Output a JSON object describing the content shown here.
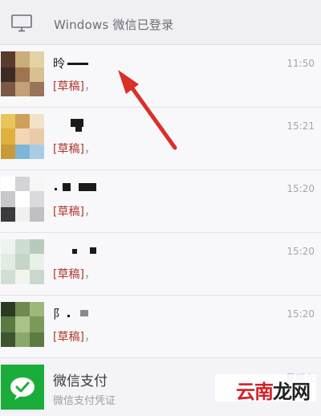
{
  "banner": {
    "text": "Windows 微信已登录",
    "icon": "monitor-icon"
  },
  "chats": [
    {
      "name_lead": "昤",
      "time": "11:50",
      "draft": "[草稿]",
      "comma": "，"
    },
    {
      "name_lead": "",
      "time": "15:21",
      "draft": "[草稿]",
      "comma": "，"
    },
    {
      "name_lead": "",
      "time": "15:20",
      "draft": "[草稿]",
      "comma": "，"
    },
    {
      "name_lead": "",
      "time": "15:20",
      "draft": "[草稿]",
      "comma": "，"
    },
    {
      "name_lead": "阝",
      "time": "15:20",
      "draft": "[草稿]",
      "comma": "，"
    }
  ],
  "pay": {
    "title": "微信支付",
    "subtitle": "微信支付凭证",
    "time": "星期六",
    "icon": "wechat-pay-icon"
  },
  "watermark": {
    "part1": "云南",
    "part2": "龙网"
  },
  "colors": {
    "draft": "#b2362b",
    "pay_green": "#1aad3b",
    "arrow": "#d9302a"
  }
}
